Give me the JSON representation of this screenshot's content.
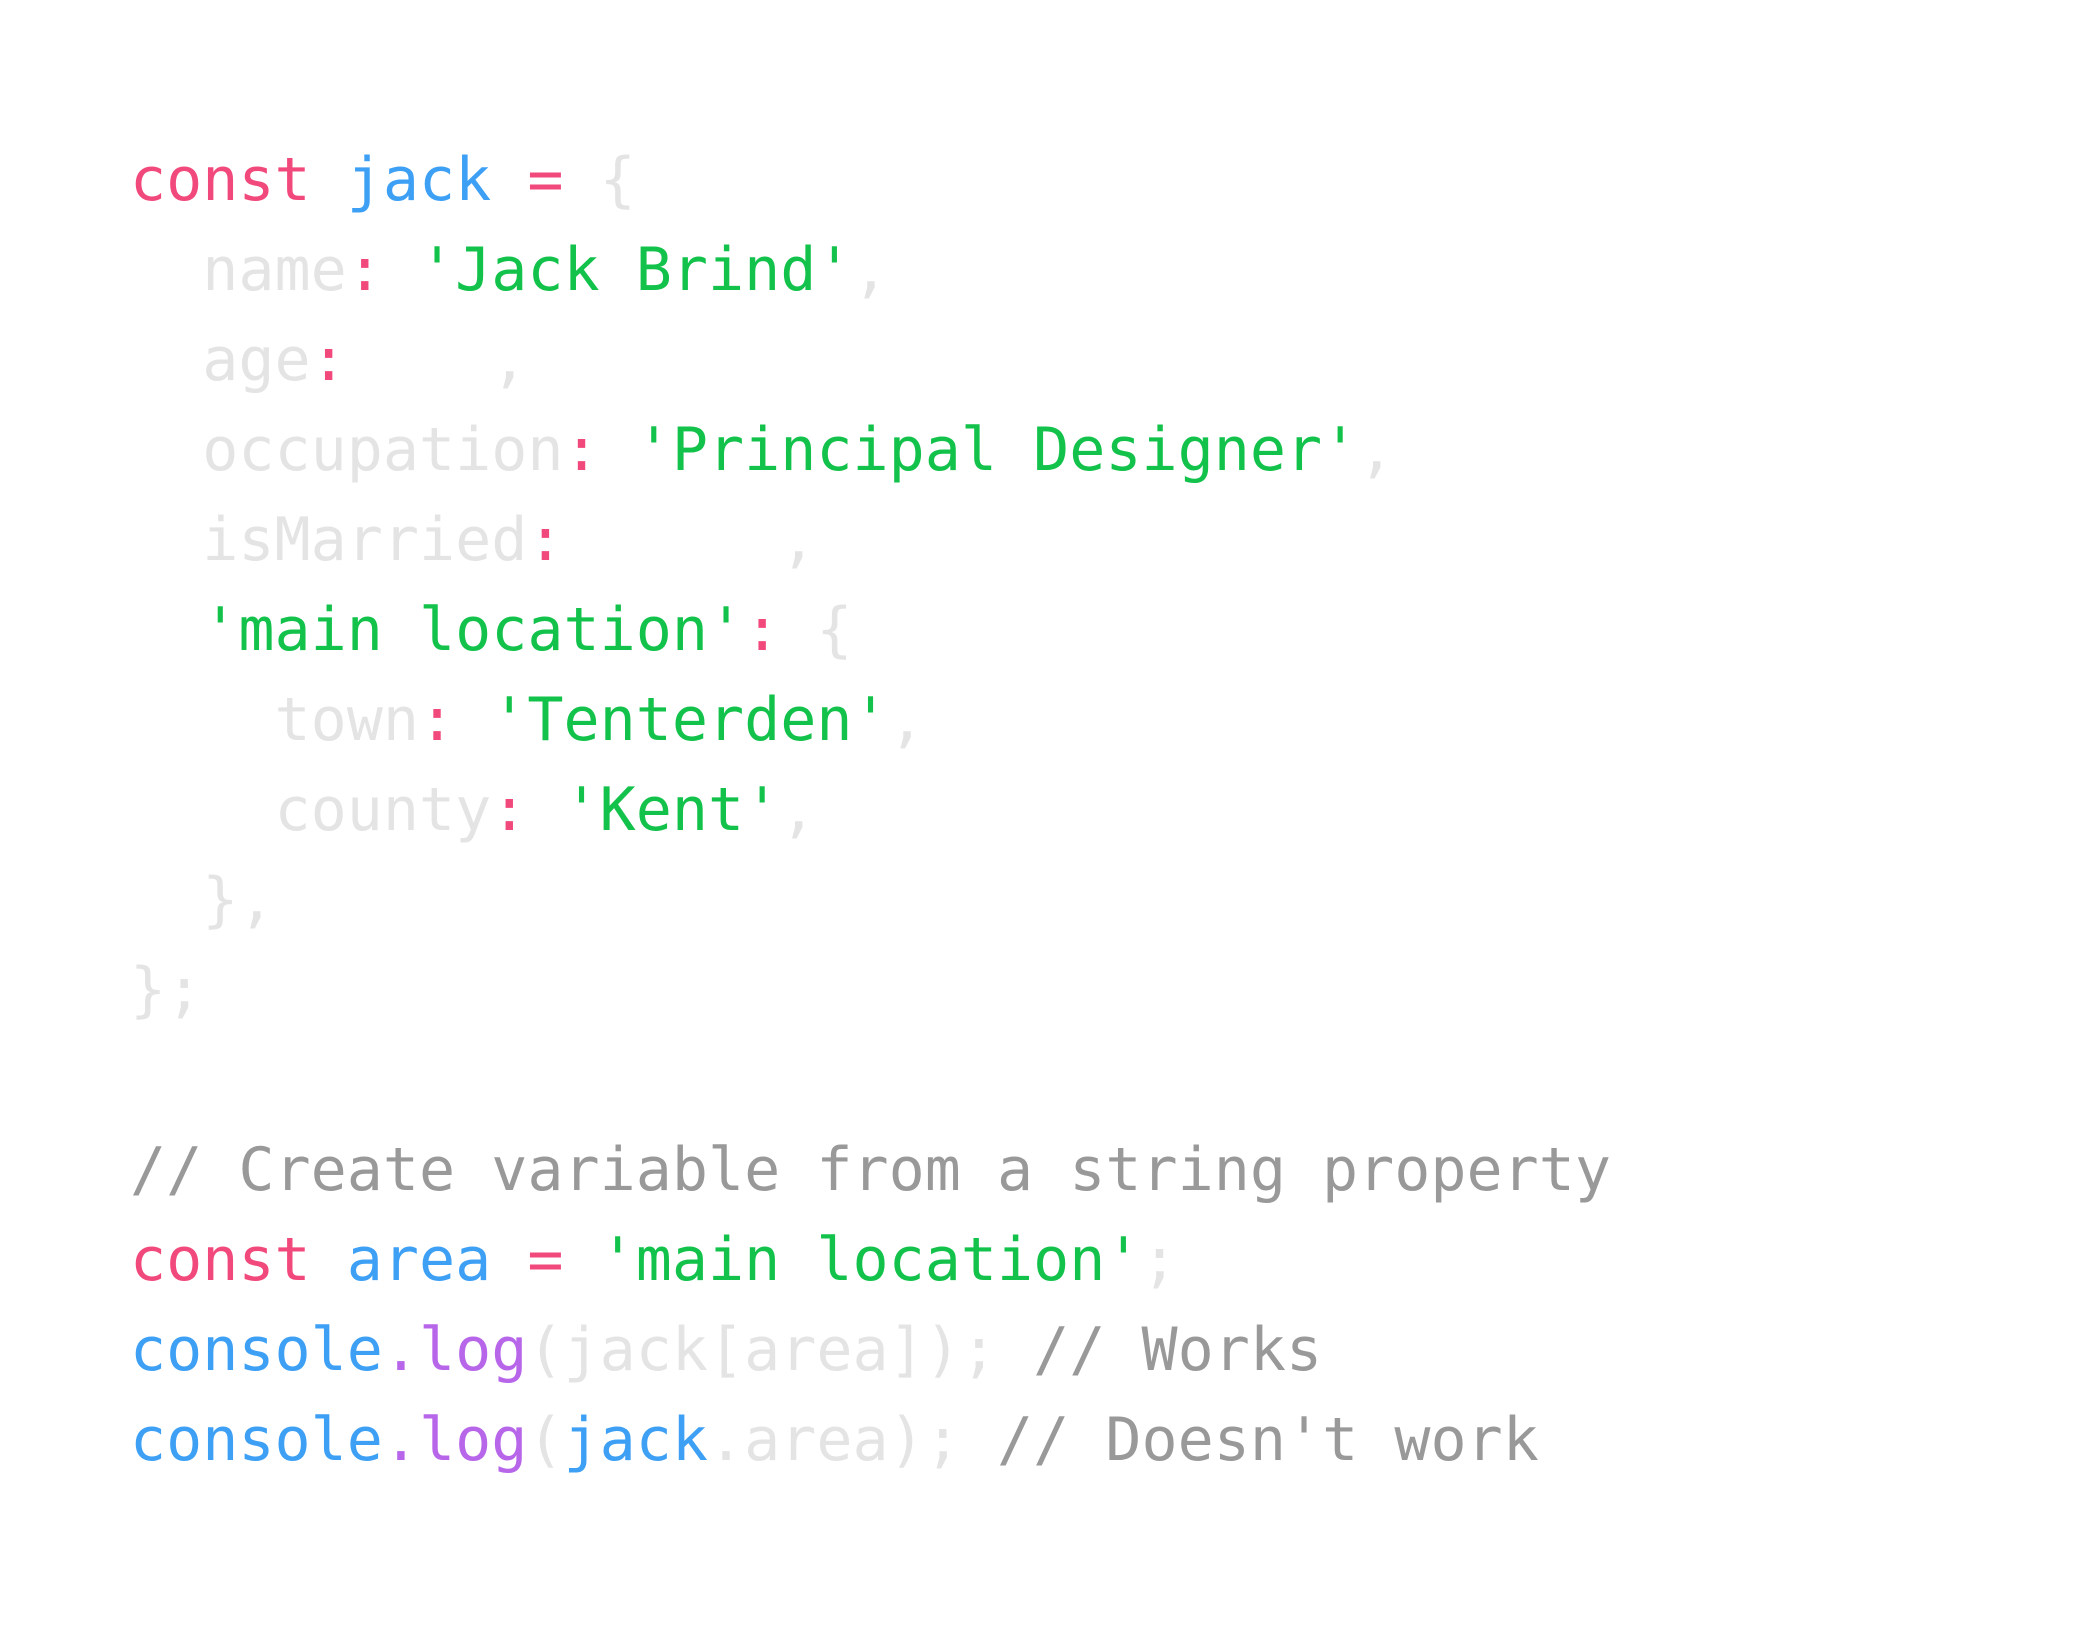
{
  "code_lines": [
    [
      {
        "t": "const",
        "c": "kw"
      },
      {
        "t": " ",
        "c": "faint"
      },
      {
        "t": "jack",
        "c": "var"
      },
      {
        "t": " ",
        "c": "faint"
      },
      {
        "t": "=",
        "c": "kw"
      },
      {
        "t": " {",
        "c": "faint"
      }
    ],
    [
      {
        "t": "  name",
        "c": "faint"
      },
      {
        "t": ":",
        "c": "kw"
      },
      {
        "t": " ",
        "c": "faint"
      },
      {
        "t": "'Jack Brind'",
        "c": "str"
      },
      {
        "t": ",",
        "c": "faint"
      }
    ],
    [
      {
        "t": "  age",
        "c": "faint"
      },
      {
        "t": ":",
        "c": "kw"
      },
      {
        "t": "    ,",
        "c": "faint"
      }
    ],
    [
      {
        "t": "  occupation",
        "c": "faint"
      },
      {
        "t": ":",
        "c": "kw"
      },
      {
        "t": " ",
        "c": "faint"
      },
      {
        "t": "'Principal Designer'",
        "c": "str"
      },
      {
        "t": ",",
        "c": "faint"
      }
    ],
    [
      {
        "t": "  isMarried",
        "c": "faint"
      },
      {
        "t": ":",
        "c": "kw"
      },
      {
        "t": "      ,",
        "c": "faint"
      }
    ],
    [
      {
        "t": "  ",
        "c": "faint"
      },
      {
        "t": "'main location'",
        "c": "str"
      },
      {
        "t": ":",
        "c": "kw"
      },
      {
        "t": " {",
        "c": "faint"
      }
    ],
    [
      {
        "t": "    town",
        "c": "faint"
      },
      {
        "t": ":",
        "c": "kw"
      },
      {
        "t": " ",
        "c": "faint"
      },
      {
        "t": "'Tenterden'",
        "c": "str"
      },
      {
        "t": ",",
        "c": "faint"
      }
    ],
    [
      {
        "t": "    county",
        "c": "faint"
      },
      {
        "t": ":",
        "c": "kw"
      },
      {
        "t": " ",
        "c": "faint"
      },
      {
        "t": "'Kent'",
        "c": "str"
      },
      {
        "t": ",",
        "c": "faint"
      }
    ],
    [
      {
        "t": "  },",
        "c": "faint"
      }
    ],
    [
      {
        "t": "};",
        "c": "faint"
      }
    ],
    [],
    [
      {
        "t": "// Create variable from a string property",
        "c": "cmt"
      }
    ],
    [
      {
        "t": "const",
        "c": "kw"
      },
      {
        "t": " ",
        "c": "faint"
      },
      {
        "t": "area",
        "c": "var"
      },
      {
        "t": " ",
        "c": "faint"
      },
      {
        "t": "=",
        "c": "kw"
      },
      {
        "t": " ",
        "c": "faint"
      },
      {
        "t": "'main location'",
        "c": "str"
      },
      {
        "t": ";",
        "c": "faint"
      }
    ],
    [
      {
        "t": "console",
        "c": "var"
      },
      {
        "t": ".",
        "c": "fn"
      },
      {
        "t": "log",
        "c": "fn"
      },
      {
        "t": "(jack[area]);",
        "c": "faint"
      },
      {
        "t": " ",
        "c": "faint"
      },
      {
        "t": "// Works",
        "c": "cmt"
      }
    ],
    [
      {
        "t": "console",
        "c": "var"
      },
      {
        "t": ".",
        "c": "fn"
      },
      {
        "t": "log",
        "c": "fn"
      },
      {
        "t": "(",
        "c": "faint"
      },
      {
        "t": "jack",
        "c": "var"
      },
      {
        "t": ".area);",
        "c": "faint"
      },
      {
        "t": " ",
        "c": "faint"
      },
      {
        "t": "// Doesn't work",
        "c": "cmt"
      }
    ]
  ]
}
